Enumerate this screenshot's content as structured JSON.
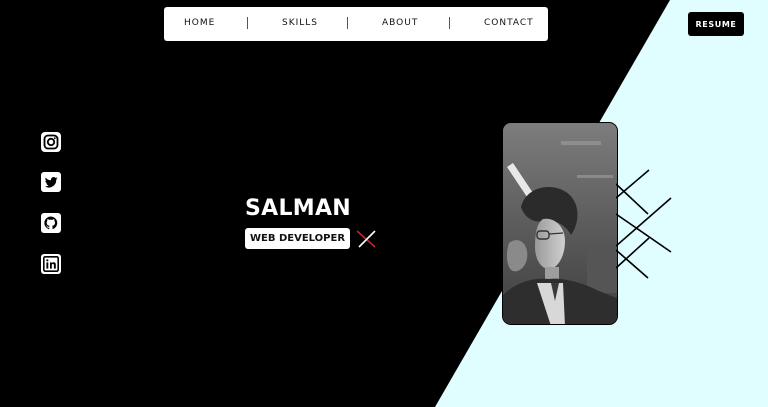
{
  "nav": {
    "items": [
      {
        "label": "HOME"
      },
      {
        "label": "SKILLS"
      },
      {
        "label": "ABOUT"
      },
      {
        "label": "CONTACT"
      }
    ]
  },
  "resume": {
    "label": "RESUME"
  },
  "social": [
    {
      "icon": "instagram-icon"
    },
    {
      "icon": "twitter-icon"
    },
    {
      "icon": "github-icon"
    },
    {
      "icon": "linkedin-icon"
    }
  ],
  "hero": {
    "name": "SALMAN",
    "role": "WEB DEVELOPER"
  },
  "colors": {
    "background": "#000000",
    "accent_panel": "#e0fdff",
    "cross_red": "#c0262c",
    "nav_bg": "#ffffff"
  }
}
